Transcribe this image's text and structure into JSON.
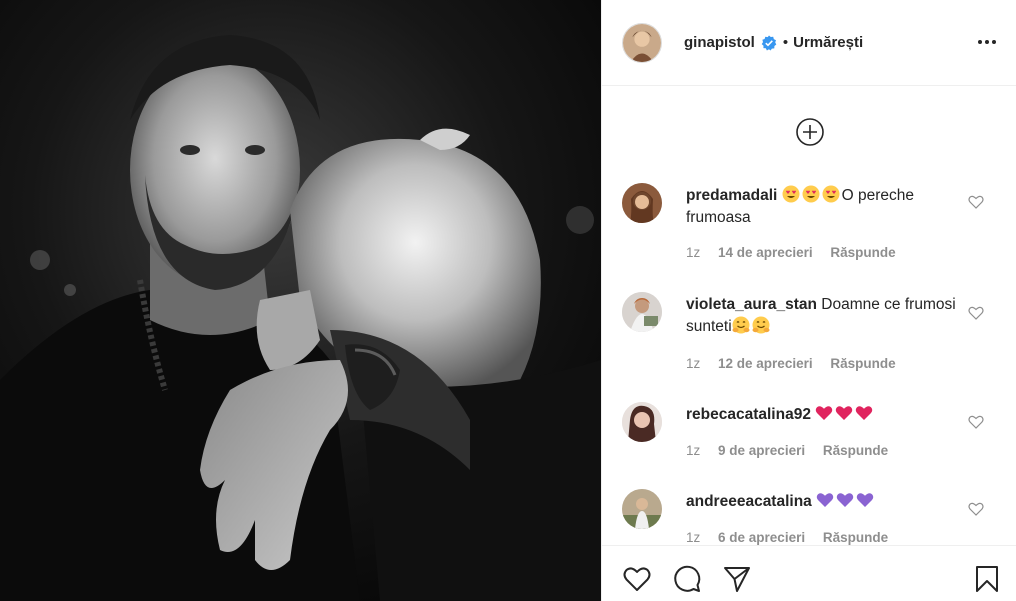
{
  "post": {
    "username": "ginapistol",
    "follow_separator": "•",
    "follow_label": "Urmărești",
    "verified": true
  },
  "comments": [
    {
      "username": "predamadali",
      "emoji_before": [
        "heart-eyes-emoji",
        "heart-eyes-emoji",
        "heart-eyes-emoji"
      ],
      "text": "O pereche frumoasa",
      "time": "1z",
      "likes": "14 de aprecieri",
      "reply": "Răspunde"
    },
    {
      "username": "violeta_aura_stan",
      "text": "Doamne ce frumosi sunteti",
      "emoji_after": [
        "hugging-emoji",
        "hugging-emoji"
      ],
      "time": "1z",
      "likes": "12 de aprecieri",
      "reply": "Răspunde"
    },
    {
      "username": "rebecacatalina92",
      "text": "",
      "emoji_after": [
        "red-heart-emoji",
        "red-heart-emoji",
        "red-heart-emoji"
      ],
      "time": "1z",
      "likes": "9 de aprecieri",
      "reply": "Răspunde"
    },
    {
      "username": "andreeeacatalina",
      "text": "",
      "emoji_after": [
        "purple-heart-emoji",
        "purple-heart-emoji",
        "purple-heart-emoji"
      ],
      "time": "1z",
      "likes": "6 de aprecieri",
      "reply": "Răspunde"
    }
  ],
  "colors": {
    "text": "#262626",
    "muted": "#8e8e8e",
    "verified": "#3897f0",
    "red_heart": "#e0245e",
    "purple_heart": "#8a63d2"
  },
  "icons": {
    "more": "more-options-icon",
    "load_more": "load-more-comments-icon",
    "like": "like-heart-icon",
    "comment": "comment-icon",
    "share": "share-icon",
    "save": "save-bookmark-icon"
  }
}
